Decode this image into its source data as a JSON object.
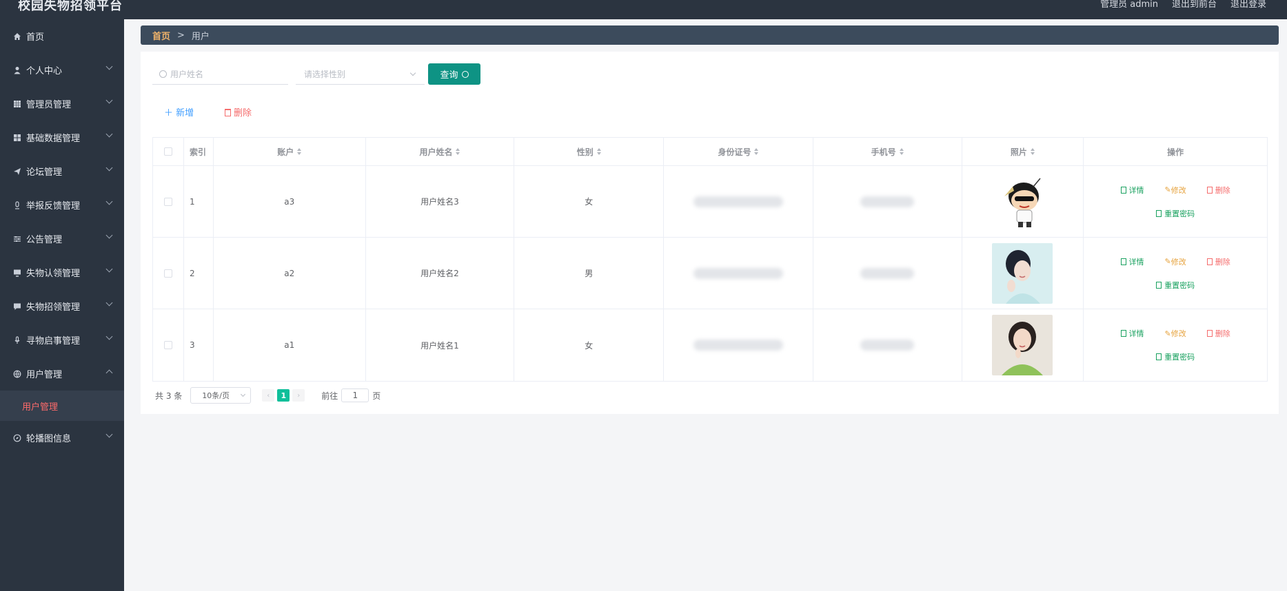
{
  "header": {
    "title": "校园失物招领平台",
    "links": [
      "管理员 admin",
      "退出到前台",
      "退出登录"
    ]
  },
  "sidebar": {
    "items": [
      {
        "label": "首页",
        "icon": "home-icon"
      },
      {
        "label": "个人中心",
        "icon": "user-icon"
      },
      {
        "label": "管理员管理",
        "icon": "grid-icon"
      },
      {
        "label": "基础数据管理",
        "icon": "apps-icon"
      },
      {
        "label": "论坛管理",
        "icon": "send-icon"
      },
      {
        "label": "举报反馈管理",
        "icon": "mic-icon"
      },
      {
        "label": "公告管理",
        "icon": "sliders-icon"
      },
      {
        "label": "失物认领管理",
        "icon": "monitor-icon"
      },
      {
        "label": "失物招领管理",
        "icon": "chat-icon"
      },
      {
        "label": "寻物启事管理",
        "icon": "microphone-icon"
      },
      {
        "label": "用户管理",
        "icon": "globe-icon"
      },
      {
        "label": "轮播图信息",
        "icon": "compass-icon"
      }
    ],
    "submenu_active": "用户管理"
  },
  "breadcrumb": {
    "home": "首页",
    "separator": ">",
    "current": "用户"
  },
  "search": {
    "name_placeholder": "用户姓名",
    "gender_placeholder": "请选择性别",
    "query_label": "查询"
  },
  "actions": {
    "add_label": "新增",
    "delete_label": "删除"
  },
  "table": {
    "columns": [
      "索引",
      "账户",
      "用户姓名",
      "性别",
      "身份证号",
      "手机号",
      "照片",
      "操作"
    ],
    "rows": [
      {
        "index": "1",
        "account": "a3",
        "name": "用户姓名3",
        "gender": "女"
      },
      {
        "index": "2",
        "account": "a2",
        "name": "用户姓名2",
        "gender": "男"
      },
      {
        "index": "3",
        "account": "a1",
        "name": "用户姓名1",
        "gender": "女"
      }
    ],
    "ops": {
      "detail": "详情",
      "edit": "修改",
      "remove": "删除",
      "reset": "重置密码"
    }
  },
  "pagination": {
    "total": "共 3 条",
    "page_size": "10条/页",
    "current_page": "1",
    "goto_prefix": "前往",
    "goto_value": "1",
    "goto_suffix": "页"
  }
}
